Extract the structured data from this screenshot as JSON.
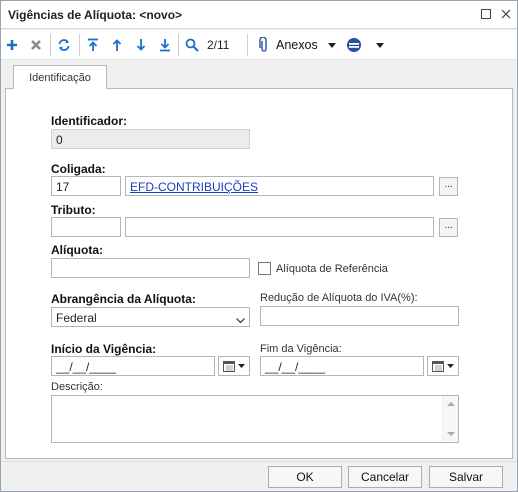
{
  "window": {
    "title": "Vigências de Alíquota: <novo>",
    "maximize_icon": "maximize-icon",
    "close_icon": "close-icon"
  },
  "toolbar": {
    "add_icon": "plus-icon",
    "delete_icon": "x-icon",
    "refresh_icon": "refresh-icon",
    "first_icon": "arrow-top-icon",
    "prev_icon": "arrow-up-icon",
    "next_icon": "arrow-down-icon",
    "last_icon": "arrow-bottom-icon",
    "search_icon": "search-icon",
    "record_position": "2/11",
    "attachments_label": "Anexos",
    "colors": {
      "blue": "#1e6fc7",
      "gray": "#8a8a8a",
      "accent": "#2a4fa0"
    }
  },
  "tabs": [
    {
      "label": "Identificação"
    }
  ],
  "form": {
    "identificador_label": "Identificador:",
    "identificador_value": "0",
    "coligada_label": "Coligada:",
    "coligada_code": "17",
    "coligada_name": "EFD-CONTRIBUIÇÕES",
    "lookup_button": "...",
    "tributo_label": "Tributo:",
    "tributo_code": "",
    "tributo_name": "",
    "aliquota_label": "Alíquota:",
    "aliquota_value": "",
    "aliquota_referencia_label": "Alíquota de Referência",
    "abrangencia_label": "Abrangência da Alíquota:",
    "abrangencia_value": "Federal",
    "reducao_label": "Redução de Alíquota do IVA(%):",
    "reducao_value": "",
    "inicio_label": "Início da Vigência:",
    "inicio_value": "__/__/____",
    "fim_label": "Fim da Vigência:",
    "fim_value": "__/__/____",
    "descricao_label": "Descrição:",
    "descricao_value": ""
  },
  "footer": {
    "ok_label": "OK",
    "cancel_label": "Cancelar",
    "save_label": "Salvar"
  }
}
